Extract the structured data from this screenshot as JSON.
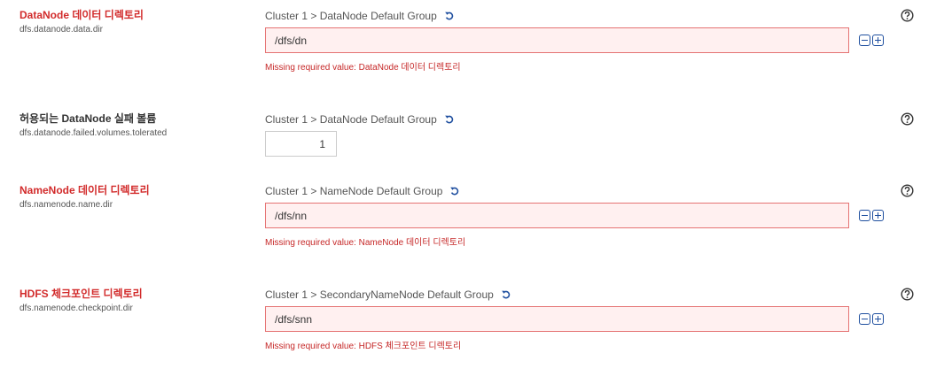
{
  "configs": [
    {
      "display_name": "DataNode 데이터 디렉토리",
      "property_name": "dfs.datanode.data.dir",
      "group": "Cluster 1 > DataNode Default Group",
      "value": "/dfs/dn",
      "error": "Missing required value: DataNode 데이터 디렉토리"
    },
    {
      "display_name": "허용되는 DataNode 실패 볼륨",
      "property_name": "dfs.datanode.failed.volumes.tolerated",
      "group": "Cluster 1 > DataNode Default Group",
      "value": "1"
    },
    {
      "display_name": "NameNode 데이터 디렉토리",
      "property_name": "dfs.namenode.name.dir",
      "group": "Cluster 1 > NameNode Default Group",
      "value": "/dfs/nn",
      "error": "Missing required value: NameNode 데이터 디렉토리"
    },
    {
      "display_name": "HDFS 체크포인트 디렉토리",
      "property_name": "dfs.namenode.checkpoint.dir",
      "group": "Cluster 1 > SecondaryNameNode Default Group",
      "value": "/dfs/snn",
      "error": "Missing required value: HDFS 체크포인트 디렉토리"
    }
  ],
  "icons": {
    "undo": "undo-icon",
    "help": "help-icon",
    "remove": "minus-box-icon",
    "add": "plus-box-icon"
  },
  "colors": {
    "error_text": "#d22b2b",
    "error_border": "#e57373",
    "error_bg": "#fff0f0",
    "accent": "#1f4f9f"
  }
}
